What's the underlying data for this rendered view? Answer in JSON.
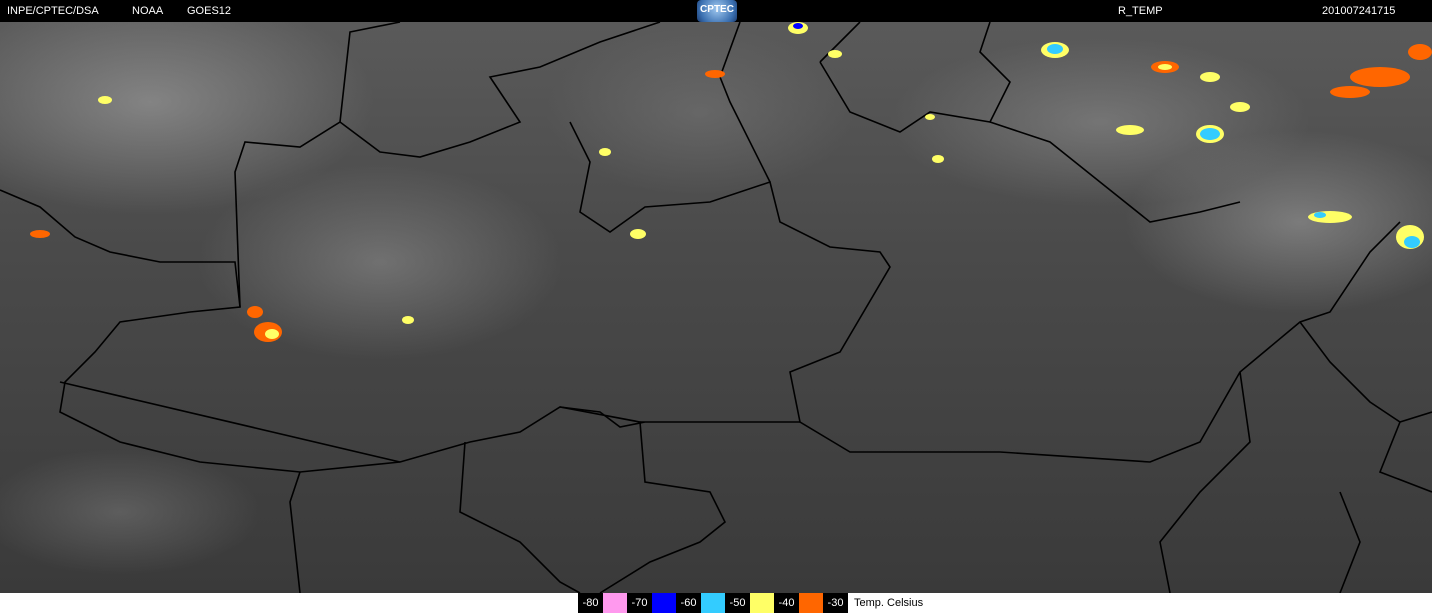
{
  "header": {
    "source": "INPE/CPTEC/DSA",
    "agency": "NOAA",
    "satellite": "GOES12",
    "logo_text": "CPTEC",
    "product": "R_TEMP",
    "datetime": "201007241715"
  },
  "legend": {
    "items": [
      {
        "label": "-80",
        "color": "#ff99ee"
      },
      {
        "label": "-70",
        "color": "#0000ff"
      },
      {
        "label": "-60",
        "color": "#33ccff"
      },
      {
        "label": "-50",
        "color": "#ffff66"
      },
      {
        "label": "-40",
        "color": "#ff6600"
      },
      {
        "label": "-30",
        "color": null
      }
    ],
    "unit": "Temp. Celsius"
  }
}
